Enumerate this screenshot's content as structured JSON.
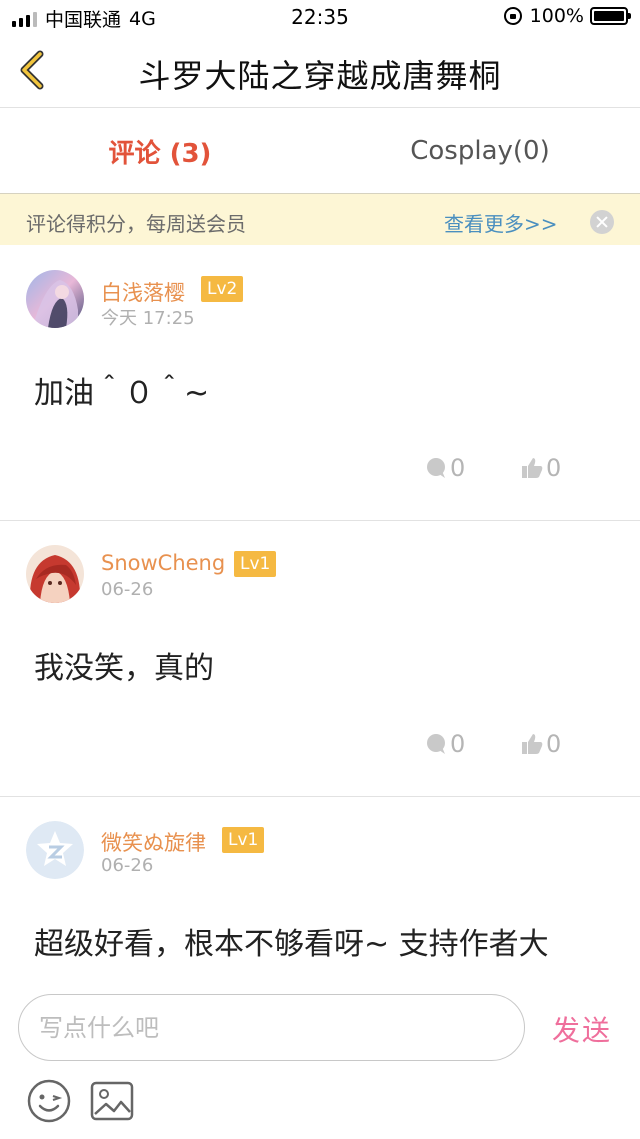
{
  "status_bar": {
    "carrier": "中国联通",
    "network": "4G",
    "time": "22:35",
    "battery": "100%"
  },
  "nav": {
    "title": "斗罗大陆之穿越成唐舞桐"
  },
  "tabs": [
    {
      "label": "评论 (3)",
      "active": true
    },
    {
      "label": "Cosplay(0)",
      "active": false
    }
  ],
  "notice": {
    "text": "评论得积分，每周送会员",
    "link": "查看更多>>"
  },
  "comments": [
    {
      "username": "白浅落樱",
      "level": "Lv2",
      "time": "今天 17:25",
      "text": "加油＾０＾~",
      "replies": "0",
      "likes": "0"
    },
    {
      "username": "SnowCheng",
      "level": "Lv1",
      "time": "06-26",
      "text": "我没笑，真的",
      "replies": "0",
      "likes": "0"
    },
    {
      "username": "微笑ぬ旋律",
      "level": "Lv1",
      "time": "06-26",
      "text": "超级好看，根本不够看呀~ 支持作者大",
      "replies": "",
      "likes": ""
    }
  ],
  "input": {
    "placeholder": "写点什么吧",
    "send_label": "发送"
  },
  "colors": {
    "accent_active_tab": "#e2533a",
    "username": "#e8914f",
    "level_badge": "#f5b942",
    "notice_bg": "#fdf6d5",
    "notice_link": "#4a8fbf",
    "send": "#ef6f9c"
  },
  "icons": {
    "back": "chevron-left-icon",
    "close": "close-icon",
    "reply": "comment-bubble-icon",
    "like": "thumbs-up-icon",
    "emoji": "smiley-icon",
    "image": "image-icon"
  }
}
